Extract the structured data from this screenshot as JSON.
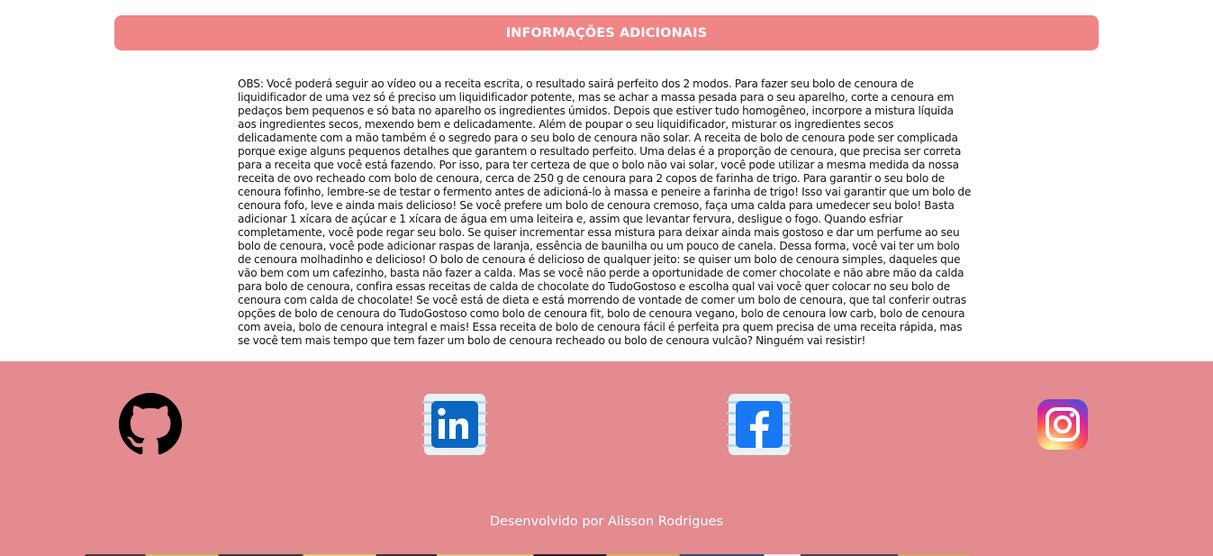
{
  "section": {
    "title": "INFORMAÇÕES ADICIONAIS"
  },
  "info": {
    "text": "OBS: Você poderá seguir ao vídeo ou a receita escrita, o resultado sairá perfeito dos 2 modos. Para fazer seu bolo de cenoura de liquidificador de uma vez só é preciso um liquidificador potente, mas se achar a massa pesada para o seu aparelho, corte a cenoura em pedaços bem pequenos e só bata no aparelho os ingredientes úmidos. Depois que estiver tudo homogêneo, incorpore a mistura líquida aos ingredientes secos, mexendo bem e delicadamente. Além de poupar o seu liquidificador, misturar os ingredientes secos delicadamente com a mão também é o segredo para o seu bolo de cenoura não solar. A receita de bolo de cenoura pode ser complicada porque exige alguns pequenos detalhes que garantem o resultado perfeito. Uma delas é a proporção de cenoura, que precisa ser correta para a receita que você está fazendo. Por isso, para ter certeza de que o bolo não vai solar, você pode utilizar a mesma medida da nossa receita de ovo recheado com bolo de cenoura, cerca de 250 g de cenoura para 2 copos de farinha de trigo. Para garantir o seu bolo de cenoura fofinho, lembre-se de testar o fermento antes de adicioná-lo à massa e peneire a farinha de trigo! Isso vai garantir que um bolo de cenoura fofo, leve e ainda mais delicioso! Se você prefere um bolo de cenoura cremoso, faça uma calda para umedecer seu bolo! Basta adicionar 1 xícara de açúcar e 1 xícara de água em uma leiteira e, assim que levantar fervura, desligue o fogo. Quando esfriar completamente, você pode regar seu bolo. Se quiser incrementar essa mistura para deixar ainda mais gostoso e dar um perfume ao seu bolo de cenoura, você pode adicionar raspas de laranja, essência de baunilha ou um pouco de canela. Dessa forma, você vai ter um bolo de cenoura molhadinho e delicioso! O bolo de cenoura é delicioso de qualquer jeito: se quiser um bolo de cenoura simples, daqueles que vão bem com um cafezinho, basta não fazer a calda. Mas se você não perde a oportunidade de comer chocolate e não abre mão da calda para bolo de cenoura, confira essas receitas de calda de chocolate do TudoGostoso e escolha qual vai você quer colocar no seu bolo de cenoura com calda de chocolate! Se você está de dieta e está morrendo de vontade de comer um bolo de cenoura, que tal conferir outras opções de bolo de cenoura do TudoGostoso como bolo de cenoura fit, bolo de cenoura vegano, bolo de cenoura low carb, bolo de cenoura com aveia, bolo de cenoura integral e mais! Essa receita de bolo de cenoura fácil é perfeita pra quem precisa de uma receita rápida, mas se você tem mais tempo que tem fazer um bolo de cenoura recheado ou bolo de cenoura vulcão? Ninguém vai resistir!"
  },
  "footer": {
    "social": [
      {
        "name": "github",
        "icon": "github-icon"
      },
      {
        "name": "linkedin",
        "icon": "linkedin-icon"
      },
      {
        "name": "facebook",
        "icon": "facebook-icon"
      },
      {
        "name": "instagram",
        "icon": "instagram-icon"
      }
    ],
    "credits": "Desenvolvido por Alisson Rodrigues"
  },
  "colors": {
    "header_bg": "#f08585",
    "footer_bg": "#e38b8f",
    "linkedin_blue": "#0a66c2",
    "facebook_blue": "#1877f2"
  }
}
